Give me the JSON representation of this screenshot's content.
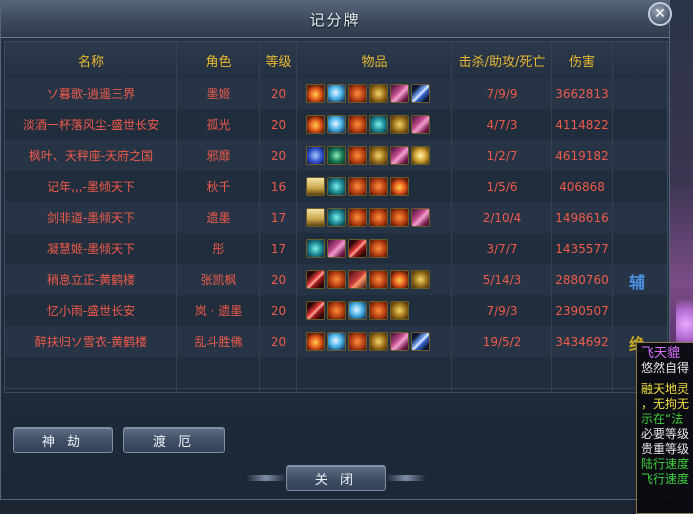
{
  "window": {
    "title": "记分牌",
    "close_icon": "✕",
    "colors": {
      "header": "#e8b830",
      "row_text": "#f05a4a"
    }
  },
  "table": {
    "columns": [
      "名称",
      "角色",
      "等级",
      "物品",
      "击杀/助攻/死亡",
      "伤害"
    ],
    "rows": [
      {
        "name": "ソ暮歌-逍遥三界",
        "role": "墨姬",
        "level": "20",
        "items": [
          "fire",
          "ice",
          "orange",
          "gold",
          "pink",
          "blade"
        ],
        "kda": "7/9/9",
        "damage": "3662813",
        "tag": ""
      },
      {
        "name": "淡酒一杯落风尘-盛世长安",
        "role": "孤光",
        "level": "20",
        "items": [
          "fire",
          "ice",
          "orange",
          "teal",
          "gold",
          "pink"
        ],
        "kda": "4/7/3",
        "damage": "4114822",
        "tag": ""
      },
      {
        "name": "枫叶、天秤座-天府之国",
        "role": "邪靡",
        "level": "20",
        "items": [
          "blue",
          "gem",
          "orange",
          "gold",
          "pink",
          "star"
        ],
        "kda": "1/2/7",
        "damage": "4619182",
        "tag": ""
      },
      {
        "name": "记年,,,-墨倾天下",
        "role": "秋千",
        "level": "16",
        "items": [
          "scroll",
          "teal",
          "orange",
          "orange",
          "fire"
        ],
        "kda": "1/5/6",
        "damage": "406868",
        "tag": ""
      },
      {
        "name": "剑非道-墨倾天下",
        "role": "遗墨",
        "level": "17",
        "items": [
          "scroll",
          "teal",
          "orange",
          "orange",
          "orange",
          "pink"
        ],
        "kda": "2/10/4",
        "damage": "1498616",
        "tag": ""
      },
      {
        "name": "凝慧姬-墨倾天下",
        "role": "彤",
        "level": "17",
        "items": [
          "teal",
          "pink",
          "red",
          "orange"
        ],
        "kda": "3/7/7",
        "damage": "1435577",
        "tag": ""
      },
      {
        "name": "稍息立正-黄鹤楼",
        "role": "张凯枫",
        "level": "20",
        "items": [
          "red",
          "orange",
          "dragon",
          "orange",
          "fire",
          "gold"
        ],
        "kda": "5/14/3",
        "damage": "2880760",
        "tag": "辅"
      },
      {
        "name": "忆小雨-盛世长安",
        "role": "岚 · 遗墨",
        "level": "20",
        "items": [
          "red",
          "orange",
          "ice",
          "orange",
          "gold"
        ],
        "kda": "7/9/3",
        "damage": "2390507",
        "tag": ""
      },
      {
        "name": "醉扶归ソ雪衣-黄鹤楼",
        "role": "乱斗胜佛",
        "level": "20",
        "items": [
          "fire",
          "ice",
          "orange",
          "gold",
          "pink",
          "blade"
        ],
        "kda": "19/5/2",
        "damage": "3434692",
        "tag": "绝"
      },
      {
        "name": "",
        "role": "",
        "level": "",
        "items": [],
        "kda": "",
        "damage": "",
        "tag": ""
      }
    ]
  },
  "buttons": {
    "shendong": "神 劫",
    "duer": "渡 厄",
    "close": "关 闭"
  },
  "tooltip": {
    "lines": [
      {
        "text": "飞天貔",
        "color": "#d870ff"
      },
      {
        "text": "悠然自得",
        "color": "#e8e8e8"
      },
      {
        "text": "",
        "color": "#e8e8e8"
      },
      {
        "text": "融天地灵",
        "color": "#f0e040"
      },
      {
        "text": "，无拘无",
        "color": "#f0e040"
      },
      {
        "text": "示在“法",
        "color": "#40d040"
      },
      {
        "text": "必要等级",
        "color": "#e8e8e8"
      },
      {
        "text": "贵重等级",
        "color": "#e8e8e8"
      },
      {
        "text": "陆行速度",
        "color": "#40d040"
      },
      {
        "text": "飞行速度",
        "color": "#40d040"
      }
    ]
  }
}
